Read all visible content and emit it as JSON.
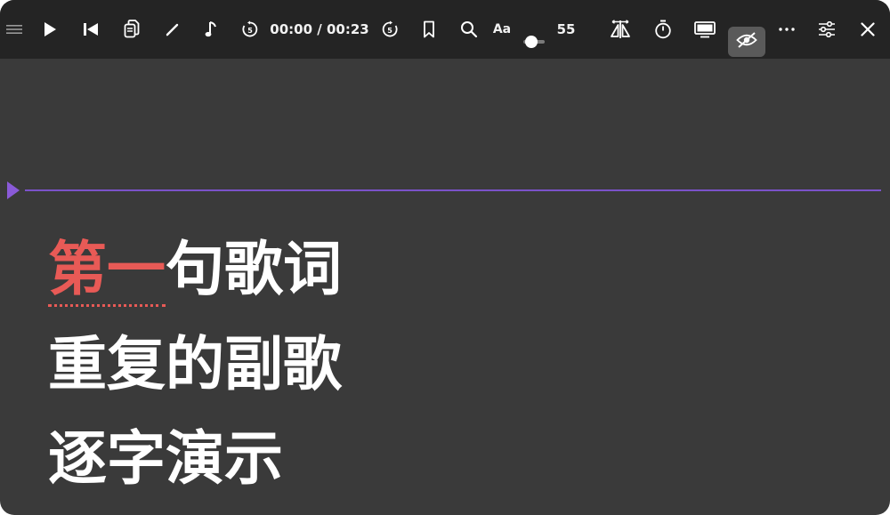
{
  "toolbar": {
    "time_display": "00:00 / 00:23",
    "font_label": "Aa",
    "font_size_value": "55",
    "font_size_fraction": 0.2,
    "icons": [
      "menu-icon",
      "play-icon",
      "skip-back-icon",
      "copy-icon",
      "pen-icon",
      "music-note-icon",
      "rewind-5-icon",
      "forward-5-icon",
      "bookmark-icon",
      "search-icon",
      "mirror-icon",
      "timer-icon",
      "display-icon",
      "eye-off-icon",
      "more-icon",
      "sliders-icon",
      "close-icon"
    ]
  },
  "colors": {
    "window_bg": "#3a3a3a",
    "toolbar_bg": "#242424",
    "guide": "#7b52c9",
    "highlight": "#e85a56",
    "lyric": "#ffffff"
  },
  "lyrics": {
    "line1_sung": "第一",
    "line1_rest": "句歌词",
    "line2": "重复的副歌",
    "line3": "逐字演示"
  }
}
